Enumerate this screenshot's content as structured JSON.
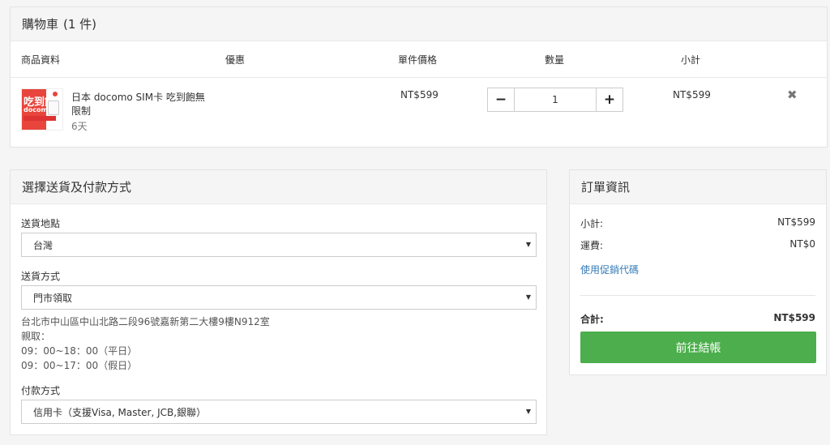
{
  "cart": {
    "title": "購物車",
    "count_label": "(1 件)",
    "columns": {
      "product": "商品資料",
      "discount": "優惠",
      "unit_price": "單件價格",
      "quantity": "數量",
      "subtotal": "小計"
    },
    "items": [
      {
        "name": "日本 docomo SIM卡 吃到飽無限制",
        "variant": "6天",
        "unit_price": "NT$599",
        "quantity": "1",
        "subtotal": "NT$599",
        "thumb_text_1": "吃到飽",
        "thumb_text_2": "docomo"
      }
    ],
    "icons": {
      "minus": "−",
      "plus": "+",
      "remove": "✖"
    }
  },
  "shipping": {
    "title": "選擇送貨及付款方式",
    "destination_label": "送貨地點",
    "destination_value": "台灣",
    "method_label": "送貨方式",
    "method_value": "門市領取",
    "address_line_1": "台北市中山區中山北路二段96號嘉新第二大樓9樓N912室",
    "address_line_2": "親取：",
    "address_line_3": "09：00~18：00（平日）",
    "address_line_4": "09：00~17：00（假日）",
    "payment_label": "付款方式",
    "payment_value": "信用卡（支援Visa, Master, JCB,銀聯）",
    "dropdown_icon": "▼"
  },
  "order": {
    "title": "訂單資訊",
    "subtotal_label": "小計:",
    "subtotal_value": "NT$599",
    "shipping_label": "運費:",
    "shipping_value": "NT$0",
    "promo_link": "使用促銷代碼",
    "total_label": "合計:",
    "total_value": "NT$599",
    "checkout_label": "前往結帳"
  },
  "colors": {
    "checkout_green": "#4cae4c",
    "link_blue": "#337ab7",
    "panel_header": "#f5f5f5"
  }
}
